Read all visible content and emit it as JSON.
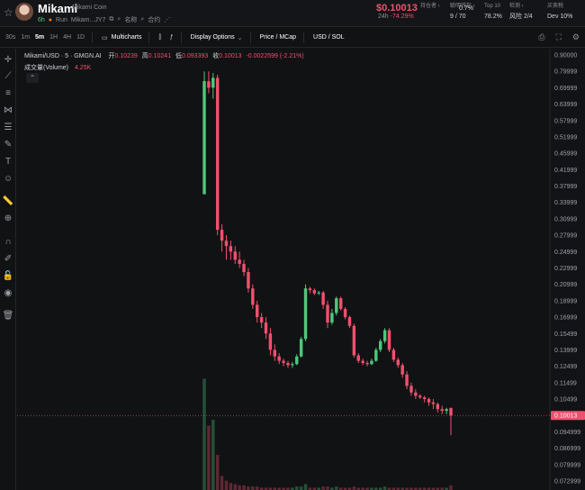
{
  "header": {
    "token_name": "Mikami",
    "token_full": "Mikami Coin",
    "age": "6h",
    "run_label": "Run",
    "contract": "Mikam...JY7",
    "name_label": "名称",
    "contract_label": "合约",
    "price": "$0.10013",
    "change_label": "24h",
    "change": "-74.29%",
    "stats": [
      {
        "label": "持仓者 ›",
        "value": ""
      },
      {
        "label": "聪明钱包 ›",
        "value": "9 / 70"
      },
      {
        "label": "",
        "value": "0.7%"
      },
      {
        "label": "Top 10",
        "value": "78.2%"
      },
      {
        "label": "检测 ›",
        "value": "风险  2/4"
      },
      {
        "label": "买卖税",
        "value": "Dev 10%"
      }
    ]
  },
  "toolbar": {
    "timeframes": [
      "30s",
      "1m",
      "5m",
      "1H",
      "4H",
      "1D"
    ],
    "active_timeframe": "5m",
    "multicharts": "Multicharts",
    "display_options": "Display Options",
    "price_toggle": "Price / MCap",
    "currency_toggle": "USD / SOL"
  },
  "tools": [
    "crosshair-icon",
    "trendline-icon",
    "horizontal-lines-icon",
    "pattern-icon",
    "fib-icon",
    "brush-icon",
    "text-icon",
    "emoji-icon",
    "ruler-icon",
    "zoom-in-icon",
    "magnet-icon",
    "lock-drawing-icon",
    "lock-icon",
    "eye-icon",
    "trash-icon"
  ],
  "legend": {
    "symbol": "Mikami/USD · 5 · GMGN.AI",
    "open_label": "开",
    "open": "0.10239",
    "high_label": "高",
    "high": "0.10241",
    "low_label": "低",
    "low": "0.093393",
    "close_label": "收",
    "close": "0.10013",
    "change": "-0.0022599 (-2.21%)",
    "volume_label": "成交量(Volume)",
    "volume": "4.25K"
  },
  "colors": {
    "up": "#4ec77a",
    "down": "#f0506e",
    "current_price": "#f0506e"
  },
  "chart_data": {
    "type": "candlestick",
    "y_ticks": [
      "0.90000",
      "0.79999",
      "0.69999",
      "0.63999",
      "0.57999",
      "0.51999",
      "0.45999",
      "0.41999",
      "0.37999",
      "0.33999",
      "0.30999",
      "0.27999",
      "0.24999",
      "0.22999",
      "0.20999",
      "0.18999",
      "0.16999",
      "0.15499",
      "0.13999",
      "0.12499",
      "0.11499",
      "0.10499",
      "0.10013",
      "0.094999",
      "0.086999",
      "0.079999",
      "0.072999"
    ],
    "current_price_label": "0.10013",
    "candles": [
      {
        "o": 0.36,
        "c": 0.74,
        "h": 0.8,
        "l": 0.36
      },
      {
        "o": 0.74,
        "c": 0.7,
        "h": 0.8,
        "l": 0.68
      },
      {
        "o": 0.7,
        "c": 0.76,
        "h": 0.79,
        "l": 0.66
      },
      {
        "o": 0.76,
        "c": 0.29,
        "h": 0.78,
        "l": 0.28
      },
      {
        "o": 0.29,
        "c": 0.27,
        "h": 0.3,
        "l": 0.25
      },
      {
        "o": 0.27,
        "c": 0.26,
        "h": 0.28,
        "l": 0.24
      },
      {
        "o": 0.26,
        "c": 0.25,
        "h": 0.27,
        "l": 0.24
      },
      {
        "o": 0.25,
        "c": 0.24,
        "h": 0.26,
        "l": 0.235
      },
      {
        "o": 0.24,
        "c": 0.235,
        "h": 0.25,
        "l": 0.23
      },
      {
        "o": 0.235,
        "c": 0.225,
        "h": 0.24,
        "l": 0.22
      },
      {
        "o": 0.225,
        "c": 0.205,
        "h": 0.23,
        "l": 0.2
      },
      {
        "o": 0.205,
        "c": 0.185,
        "h": 0.21,
        "l": 0.18
      },
      {
        "o": 0.185,
        "c": 0.17,
        "h": 0.19,
        "l": 0.165
      },
      {
        "o": 0.17,
        "c": 0.165,
        "h": 0.175,
        "l": 0.16
      },
      {
        "o": 0.165,
        "c": 0.155,
        "h": 0.17,
        "l": 0.15
      },
      {
        "o": 0.155,
        "c": 0.14,
        "h": 0.16,
        "l": 0.135
      },
      {
        "o": 0.14,
        "c": 0.134,
        "h": 0.145,
        "l": 0.13
      },
      {
        "o": 0.134,
        "c": 0.13,
        "h": 0.137,
        "l": 0.127
      },
      {
        "o": 0.13,
        "c": 0.128,
        "h": 0.132,
        "l": 0.125
      },
      {
        "o": 0.128,
        "c": 0.126,
        "h": 0.13,
        "l": 0.124
      },
      {
        "o": 0.126,
        "c": 0.127,
        "h": 0.129,
        "l": 0.124
      },
      {
        "o": 0.127,
        "c": 0.134,
        "h": 0.136,
        "l": 0.126
      },
      {
        "o": 0.134,
        "c": 0.15,
        "h": 0.152,
        "l": 0.133
      },
      {
        "o": 0.15,
        "c": 0.205,
        "h": 0.21,
        "l": 0.148
      },
      {
        "o": 0.205,
        "c": 0.203,
        "h": 0.207,
        "l": 0.199
      },
      {
        "o": 0.203,
        "c": 0.199,
        "h": 0.205,
        "l": 0.197
      },
      {
        "o": 0.199,
        "c": 0.2,
        "h": 0.202,
        "l": 0.197
      },
      {
        "o": 0.2,
        "c": 0.185,
        "h": 0.202,
        "l": 0.18
      },
      {
        "o": 0.185,
        "c": 0.165,
        "h": 0.19,
        "l": 0.16
      },
      {
        "o": 0.165,
        "c": 0.175,
        "h": 0.18,
        "l": 0.163
      },
      {
        "o": 0.175,
        "c": 0.193,
        "h": 0.195,
        "l": 0.172
      },
      {
        "o": 0.193,
        "c": 0.18,
        "h": 0.195,
        "l": 0.178
      },
      {
        "o": 0.18,
        "c": 0.17,
        "h": 0.182,
        "l": 0.168
      },
      {
        "o": 0.17,
        "c": 0.162,
        "h": 0.172,
        "l": 0.16
      },
      {
        "o": 0.162,
        "c": 0.135,
        "h": 0.164,
        "l": 0.133
      },
      {
        "o": 0.135,
        "c": 0.13,
        "h": 0.137,
        "l": 0.128
      },
      {
        "o": 0.13,
        "c": 0.128,
        "h": 0.132,
        "l": 0.126
      },
      {
        "o": 0.128,
        "c": 0.127,
        "h": 0.13,
        "l": 0.125
      },
      {
        "o": 0.127,
        "c": 0.13,
        "h": 0.132,
        "l": 0.126
      },
      {
        "o": 0.13,
        "c": 0.14,
        "h": 0.142,
        "l": 0.129
      },
      {
        "o": 0.14,
        "c": 0.148,
        "h": 0.15,
        "l": 0.138
      },
      {
        "o": 0.148,
        "c": 0.158,
        "h": 0.16,
        "l": 0.146
      },
      {
        "o": 0.158,
        "c": 0.14,
        "h": 0.16,
        "l": 0.138
      },
      {
        "o": 0.14,
        "c": 0.131,
        "h": 0.142,
        "l": 0.129
      },
      {
        "o": 0.131,
        "c": 0.126,
        "h": 0.133,
        "l": 0.124
      },
      {
        "o": 0.126,
        "c": 0.12,
        "h": 0.128,
        "l": 0.118
      },
      {
        "o": 0.12,
        "c": 0.113,
        "h": 0.122,
        "l": 0.111
      },
      {
        "o": 0.113,
        "c": 0.109,
        "h": 0.115,
        "l": 0.107
      },
      {
        "o": 0.109,
        "c": 0.107,
        "h": 0.111,
        "l": 0.105
      },
      {
        "o": 0.107,
        "c": 0.106,
        "h": 0.108,
        "l": 0.105
      },
      {
        "o": 0.106,
        "c": 0.105,
        "h": 0.107,
        "l": 0.104
      },
      {
        "o": 0.105,
        "c": 0.104,
        "h": 0.106,
        "l": 0.103
      },
      {
        "o": 0.104,
        "c": 0.1035,
        "h": 0.105,
        "l": 0.102
      },
      {
        "o": 0.1035,
        "c": 0.102,
        "h": 0.104,
        "l": 0.101
      },
      {
        "o": 0.102,
        "c": 0.1015,
        "h": 0.103,
        "l": 0.1005
      },
      {
        "o": 0.1015,
        "c": 0.102,
        "h": 0.1024,
        "l": 0.1005
      },
      {
        "o": 0.10239,
        "c": 0.10013,
        "h": 0.10241,
        "l": 0.093393
      }
    ],
    "volume_bars": [
      0.95,
      0.55,
      0.6,
      0.3,
      0.12,
      0.08,
      0.06,
      0.05,
      0.04,
      0.04,
      0.03,
      0.03,
      0.03,
      0.02,
      0.02,
      0.02,
      0.02,
      0.02,
      0.02,
      0.02,
      0.02,
      0.03,
      0.03,
      0.05,
      0.02,
      0.02,
      0.02,
      0.03,
      0.03,
      0.02,
      0.03,
      0.02,
      0.02,
      0.02,
      0.03,
      0.02,
      0.02,
      0.02,
      0.02,
      0.02,
      0.02,
      0.03,
      0.02,
      0.02,
      0.02,
      0.02,
      0.02,
      0.02,
      0.02,
      0.02,
      0.02,
      0.02,
      0.02,
      0.02,
      0.02,
      0.02,
      0.04
    ]
  }
}
